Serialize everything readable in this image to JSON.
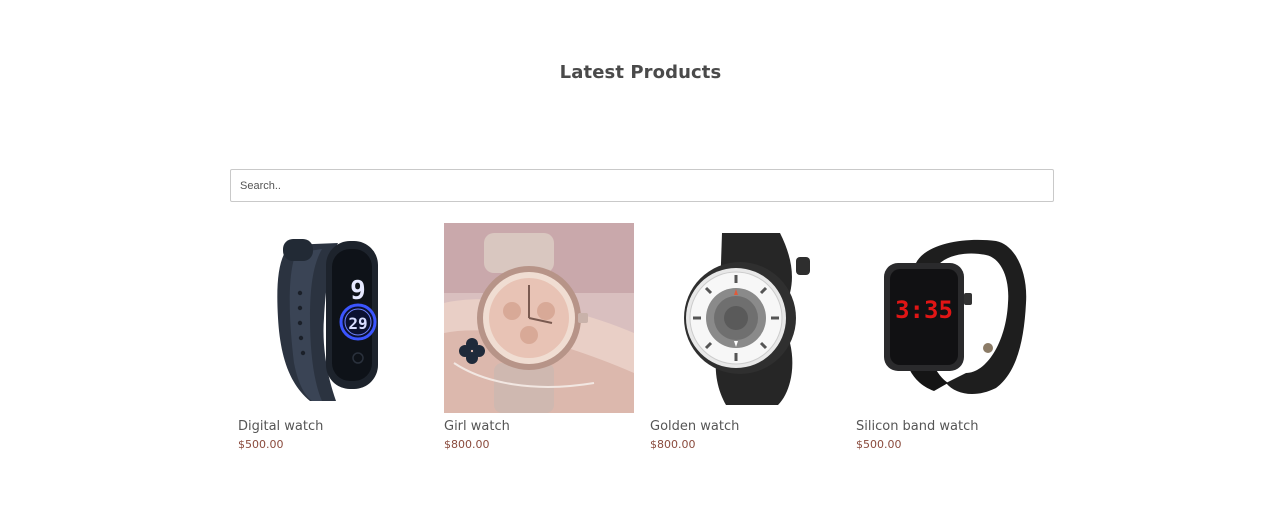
{
  "section": {
    "title": "Latest Products"
  },
  "search": {
    "placeholder": "Search..",
    "value": ""
  },
  "products": [
    {
      "name": "Digital watch",
      "price": "$500.00",
      "image_icon": "digital-band-watch-image",
      "display_top": "9",
      "display_bottom": "29"
    },
    {
      "name": "Girl watch",
      "price": "$800.00",
      "image_icon": "rose-gold-wrist-watch-image"
    },
    {
      "name": "Golden watch",
      "price": "$800.00",
      "image_icon": "rotating-dial-watch-image"
    },
    {
      "name": "Silicon band watch",
      "price": "$500.00",
      "image_icon": "square-led-watch-image",
      "display_time": "3:35"
    }
  ]
}
